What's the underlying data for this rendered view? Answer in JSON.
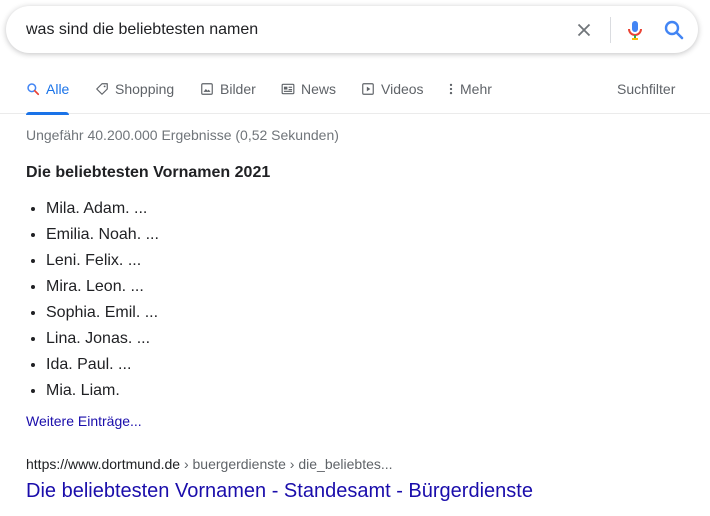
{
  "search": {
    "query": "was sind die beliebtesten namen"
  },
  "tabs": [
    {
      "label": "Alle",
      "icon": "search-icon",
      "active": true
    },
    {
      "label": "Shopping",
      "icon": "tag-icon"
    },
    {
      "label": "Bilder",
      "icon": "image-icon"
    },
    {
      "label": "News",
      "icon": "news-icon"
    },
    {
      "label": "Videos",
      "icon": "video-icon"
    },
    {
      "label": "Mehr",
      "icon": "more-vert-icon"
    }
  ],
  "tools_label": "Suchfilter",
  "result_stats": "Ungefähr 40.200.000 Ergebnisse (0,52 Sekunden)",
  "snippet": {
    "title": "Die beliebtesten Vornamen 2021",
    "items": [
      "Mila. Adam. ...",
      "Emilia. Noah. ...",
      "Leni. Felix. ...",
      "Mira. Leon. ...",
      "Sophia. Emil. ...",
      "Lina. Jonas. ...",
      "Ida. Paul. ...",
      "Mia. Liam."
    ],
    "more_link": "Weitere Einträge..."
  },
  "result": {
    "url_domain": "https://www.dortmund.de",
    "url_crumbs": " › buergerdienste › die_beliebtes...",
    "title": "Die beliebtesten Vornamen - Standesamt - Bürgerdienste"
  },
  "colors": {
    "accent": "#1a73e8",
    "link": "#1a0dab",
    "muted": "#70757a"
  }
}
